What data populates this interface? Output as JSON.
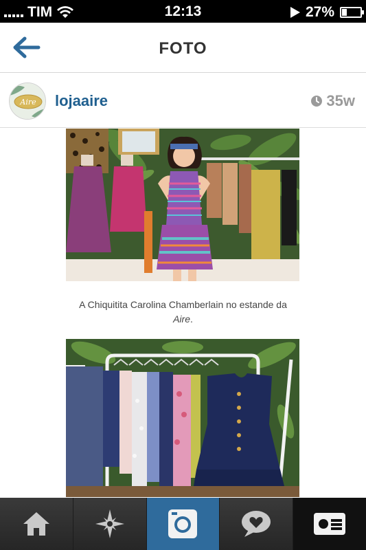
{
  "status_bar": {
    "carrier": "TIM",
    "time": "12:13",
    "battery": "27%",
    "battery_level": 0.27
  },
  "nav": {
    "title": "FOTO",
    "back_icon": "arrow-left-icon"
  },
  "post": {
    "username": "lojaaire",
    "avatar_text": "Aire",
    "time_ago": "35w",
    "caption_text": "A Chiquitita Carolina Chamberlain no estande da",
    "caption_brand": "Aire",
    "caption_end": "."
  },
  "tabs": [
    {
      "name": "home",
      "icon": "home-icon"
    },
    {
      "name": "explore",
      "icon": "explore-star-icon"
    },
    {
      "name": "camera",
      "icon": "camera-icon",
      "active": true
    },
    {
      "name": "activity",
      "icon": "activity-heart-icon"
    },
    {
      "name": "profile",
      "icon": "profile-card-icon"
    }
  ],
  "colors": {
    "link": "#1f5f8f",
    "tab_active": "#2f6b9c",
    "status_bar": "#000000"
  }
}
